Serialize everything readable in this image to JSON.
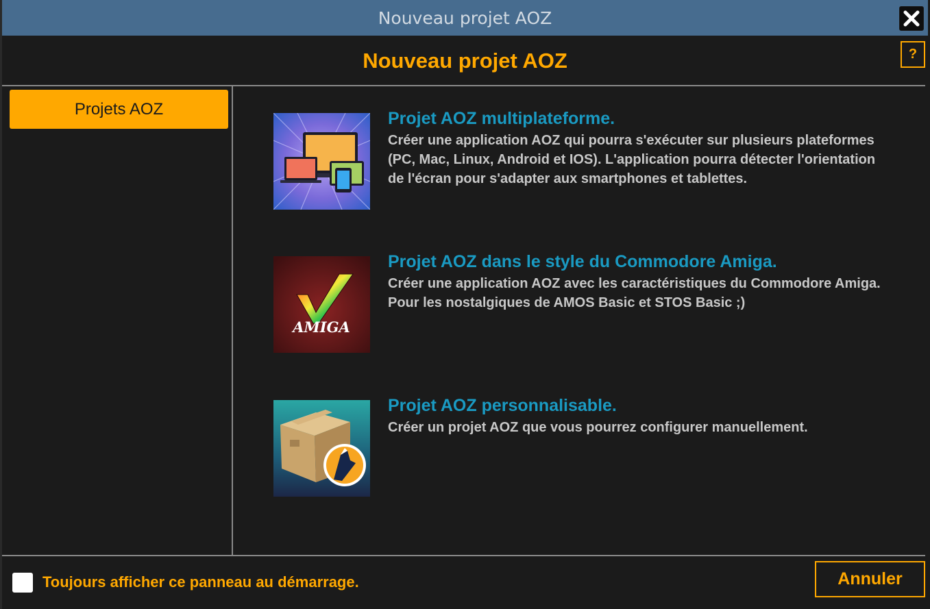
{
  "window": {
    "title": "Nouveau projet AOZ",
    "close_icon": "close-icon"
  },
  "header": {
    "title": "Nouveau projet AOZ",
    "help_label": "?"
  },
  "sidebar": {
    "items": [
      {
        "label": "Projets AOZ",
        "selected": true
      }
    ]
  },
  "projects": [
    {
      "title": "Projet AOZ multiplateforme.",
      "description": "Créer une application AOZ qui pourra s'exécuter sur plusieurs plateformes (PC, Mac, Linux, Android et IOS). L'application pourra détecter l'orientation de l'écran pour s'adapter aux smartphones et tablettes.",
      "icon": "devices-icon"
    },
    {
      "title": "Projet AOZ dans le style du Commodore Amiga.",
      "description": "Créer une application AOZ avec les caractéristiques du Commodore Amiga. Pour les nostalgiques de AMOS Basic et STOS Basic ;)",
      "icon": "amiga-logo-icon",
      "logo_text": "AMIGA"
    },
    {
      "title": "Projet AOZ personnalisable.",
      "description": "Créer un projet AOZ que vous pourrez configurer manuellement.",
      "icon": "package-box-icon"
    }
  ],
  "footer": {
    "checkbox_label": "Toujours afficher ce panneau au démarrage.",
    "checkbox_checked": false,
    "cancel_label": "Annuler"
  },
  "colors": {
    "accent": "#ffa800",
    "title_bar": "#476c8f",
    "link_blue": "#1a9ac2",
    "background": "#1b1b1b"
  }
}
